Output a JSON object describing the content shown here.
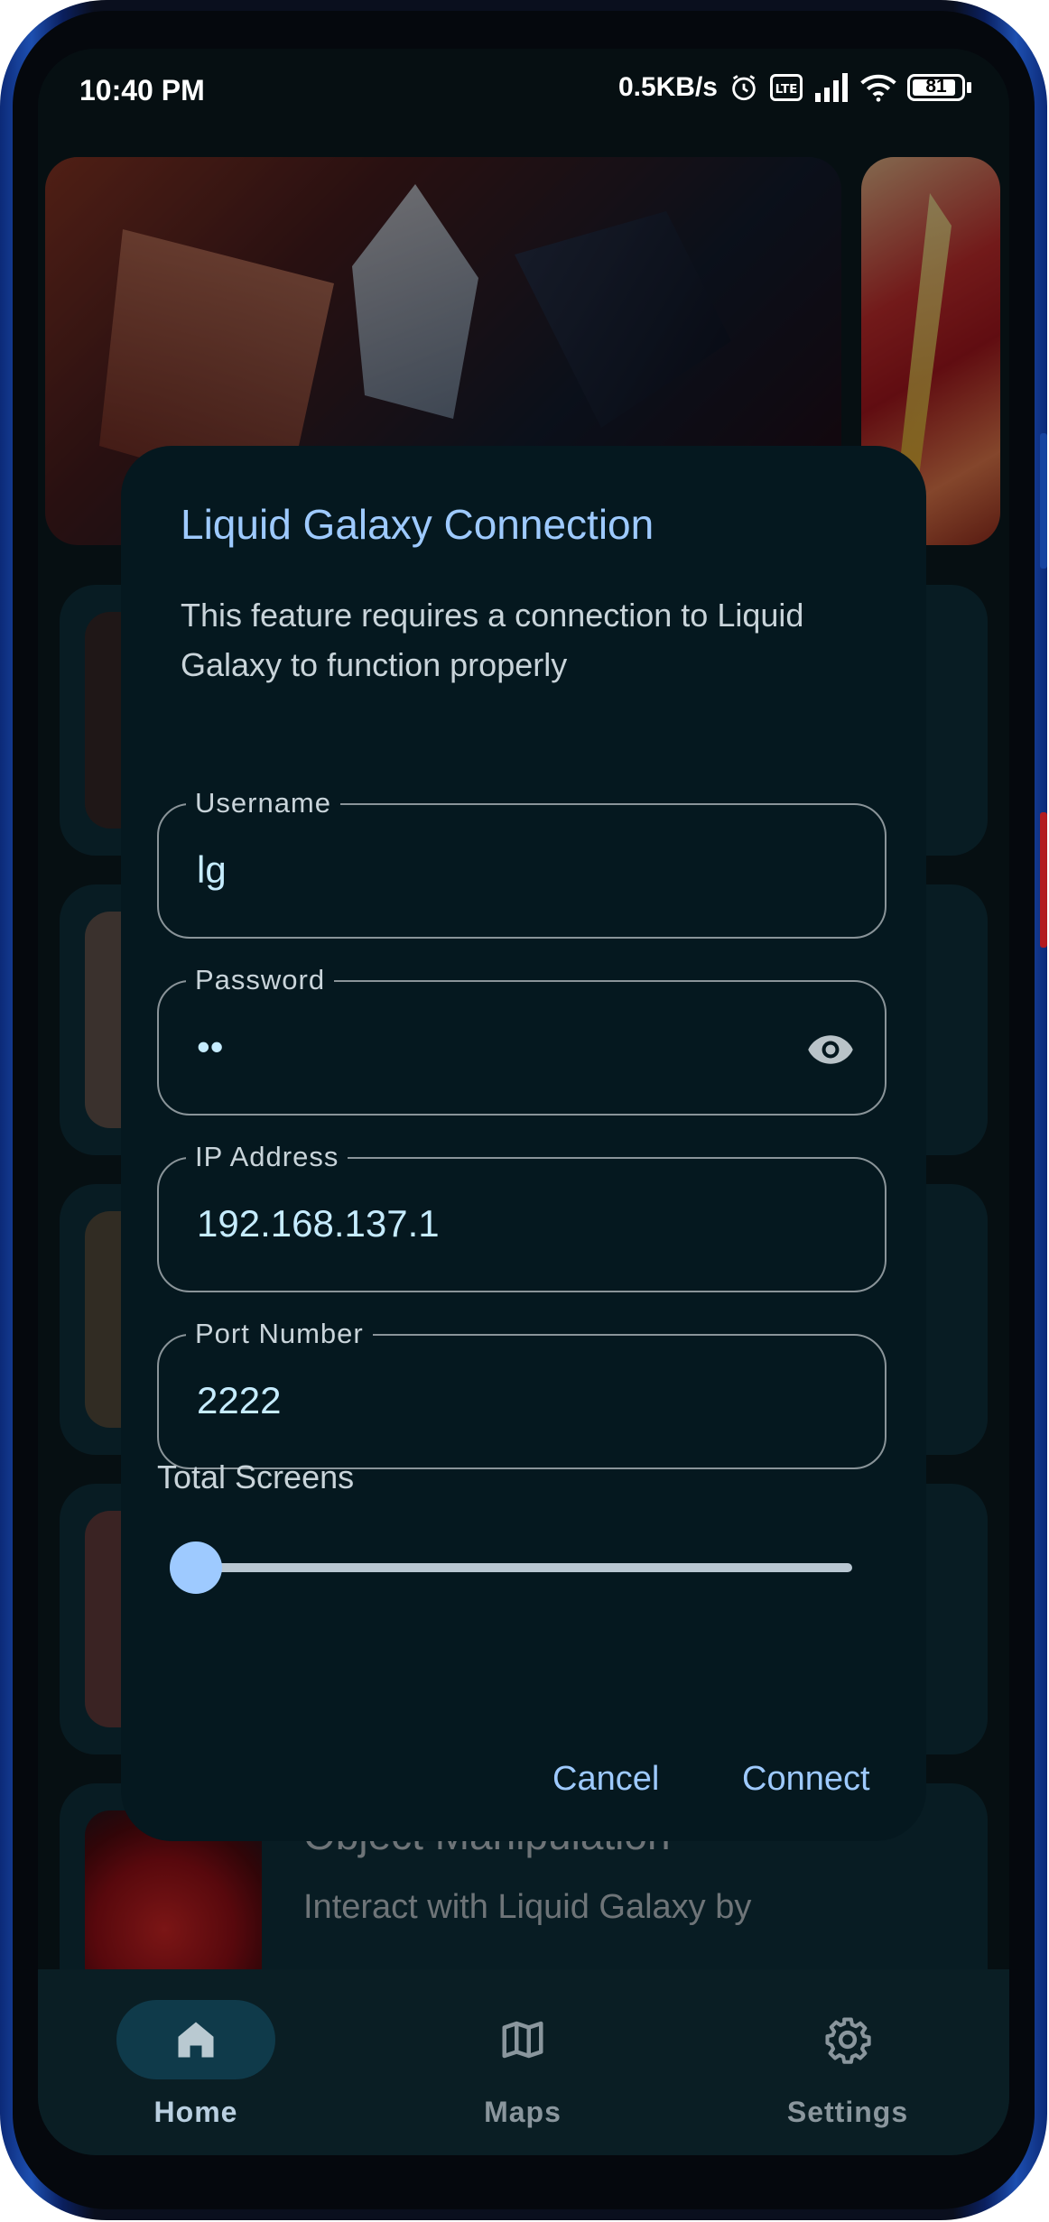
{
  "status_bar": {
    "time": "10:40 PM",
    "network_speed": "0.5KB/s",
    "battery": "81",
    "icons": [
      "alarm-icon",
      "volte-icon",
      "signal-icon",
      "wifi-icon",
      "battery-icon"
    ]
  },
  "background": {
    "list_item": {
      "title": "Object Manipulation",
      "description": "Interact with Liquid Galaxy by"
    }
  },
  "dialog": {
    "title": "Liquid Galaxy Connection",
    "body": "This feature requires a connection to Liquid Galaxy to function properly",
    "fields": {
      "username": {
        "label": "Username",
        "value": "lg"
      },
      "password": {
        "label": "Password",
        "value": "••"
      },
      "ip": {
        "label": "IP Address",
        "value": "192.168.137.1"
      },
      "port": {
        "label": "Port Number",
        "value": "2222"
      }
    },
    "slider": {
      "label": "Total Screens",
      "value_fraction": 0.0
    },
    "cancel_label": "Cancel",
    "connect_label": "Connect"
  },
  "nav": {
    "items": [
      {
        "label": "Home",
        "icon": "home-icon",
        "selected": true
      },
      {
        "label": "Maps",
        "icon": "map-icon",
        "selected": false
      },
      {
        "label": "Settings",
        "icon": "gear-icon",
        "selected": false
      }
    ]
  },
  "colors": {
    "accent": "#9ecaff",
    "surface": "#05181f",
    "background": "#0c1c22"
  }
}
